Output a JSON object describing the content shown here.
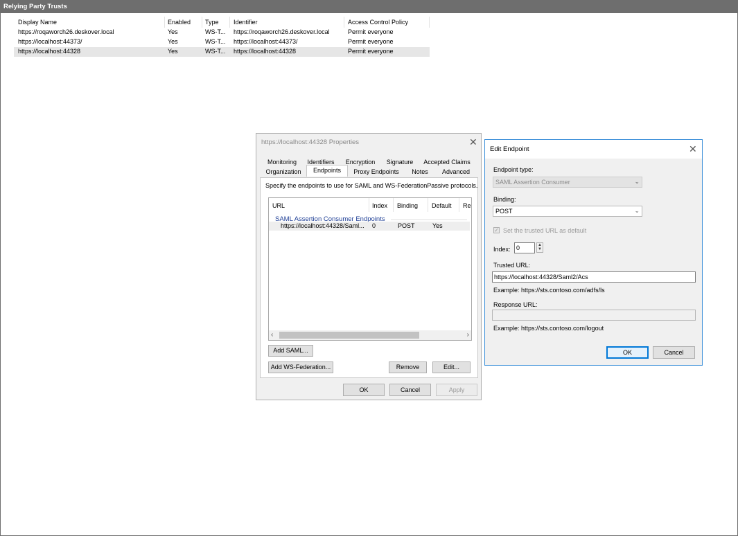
{
  "window": {
    "title": "Relying Party Trusts"
  },
  "trust_list": {
    "columns": [
      "Display Name",
      "Enabled",
      "Type",
      "Identifier",
      "Access Control Policy"
    ],
    "rows": [
      {
        "name": "https://roqaworch26.deskover.local",
        "enabled": "Yes",
        "type": "WS-T...",
        "identifier": "https://roqaworch26.deskover.local",
        "policy": "Permit everyone"
      },
      {
        "name": "https://localhost:44373/",
        "enabled": "Yes",
        "type": "WS-T...",
        "identifier": "https://localhost:44373/",
        "policy": "Permit everyone"
      },
      {
        "name": "https://localhost:44328",
        "enabled": "Yes",
        "type": "WS-T...",
        "identifier": "https://localhost:44328",
        "policy": "Permit everyone"
      }
    ]
  },
  "properties_dialog": {
    "title": "https://localhost:44328 Properties",
    "tabs_row1": [
      "Monitoring",
      "Identifiers",
      "Encryption",
      "Signature",
      "Accepted Claims"
    ],
    "tabs_row2": [
      "Organization",
      "Endpoints",
      "Proxy Endpoints",
      "Notes",
      "Advanced"
    ],
    "active_tab": "Endpoints",
    "description": "Specify the endpoints to use for SAML and WS-FederationPassive protocols.",
    "endpoint_columns": [
      "URL",
      "Index",
      "Binding",
      "Default",
      "Re"
    ],
    "group_label": "SAML Assertion Consumer Endpoints",
    "endpoint_row": {
      "url": "https://localhost:44328/Saml...",
      "index": "0",
      "binding": "POST",
      "default": "Yes"
    },
    "add_saml_label": "Add SAML...",
    "add_wsfed_label": "Add WS-Federation...",
    "remove_label": "Remove",
    "edit_label": "Edit...",
    "ok_label": "OK",
    "cancel_label": "Cancel",
    "apply_label": "Apply"
  },
  "edit_endpoint": {
    "title": "Edit Endpoint",
    "endpoint_type_label": "Endpoint type:",
    "endpoint_type_value": "SAML Assertion Consumer",
    "binding_label": "Binding:",
    "binding_value": "POST",
    "default_checkbox_label": "Set the trusted URL as default",
    "default_checked": true,
    "index_label": "Index:",
    "index_value": "0",
    "trusted_url_label": "Trusted URL:",
    "trusted_url_value": "https://localhost:44328/Saml2/Acs",
    "trusted_url_example": "Example: https://sts.contoso.com/adfs/ls",
    "response_url_label": "Response URL:",
    "response_url_value": "",
    "response_url_example": "Example: https://sts.contoso.com/logout",
    "ok_label": "OK",
    "cancel_label": "Cancel"
  }
}
